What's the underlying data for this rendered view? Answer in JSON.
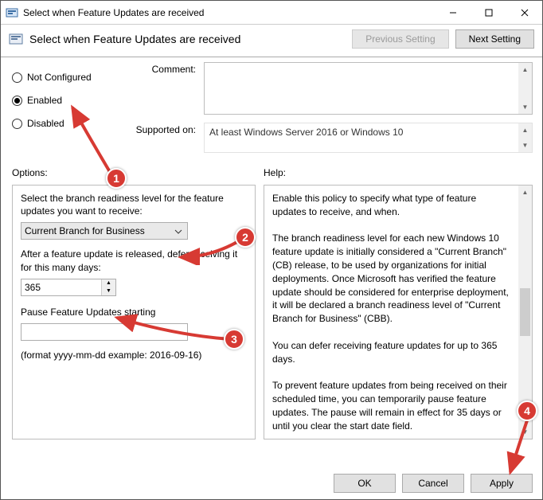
{
  "window": {
    "title": "Select when Feature Updates are received",
    "subtitle": "Select when Feature Updates are received"
  },
  "nav": {
    "prev": "Previous Setting",
    "next": "Next Setting"
  },
  "state": {
    "not_configured": "Not Configured",
    "enabled": "Enabled",
    "disabled": "Disabled",
    "selected": "enabled"
  },
  "labels": {
    "comment": "Comment:",
    "supported_on": "Supported on:",
    "options": "Options:",
    "help": "Help:"
  },
  "supported_on": "At least Windows Server 2016 or Windows 10",
  "options": {
    "branch_label": "Select the branch readiness level for the feature updates you want to receive:",
    "branch_value": "Current Branch for Business",
    "defer_label": "After a feature update is released, defer receiving it for this many days:",
    "defer_value": "365",
    "pause_label": "Pause Feature Updates starting",
    "pause_value": "",
    "format_hint": "(format yyyy-mm-dd example: 2016-09-16)"
  },
  "help_text": "Enable this policy to specify what type of feature updates to receive, and when.\n\nThe branch readiness level for each new Windows 10 feature update is initially considered a \"Current Branch\" (CB) release, to be used by organizations for initial deployments. Once Microsoft has verified the feature update should be considered for enterprise deployment, it will be declared a branch readiness level of \"Current Branch for Business\" (CBB).\n\nYou can defer receiving feature updates for up to 365 days.\n\nTo prevent feature updates from being received on their scheduled time, you can temporarily pause feature updates. The pause will remain in effect for 35 days or until you clear the start date field.",
  "footer": {
    "ok": "OK",
    "cancel": "Cancel",
    "apply": "Apply"
  },
  "annotations": {
    "b1": "1",
    "b2": "2",
    "b3": "3",
    "b4": "4"
  }
}
